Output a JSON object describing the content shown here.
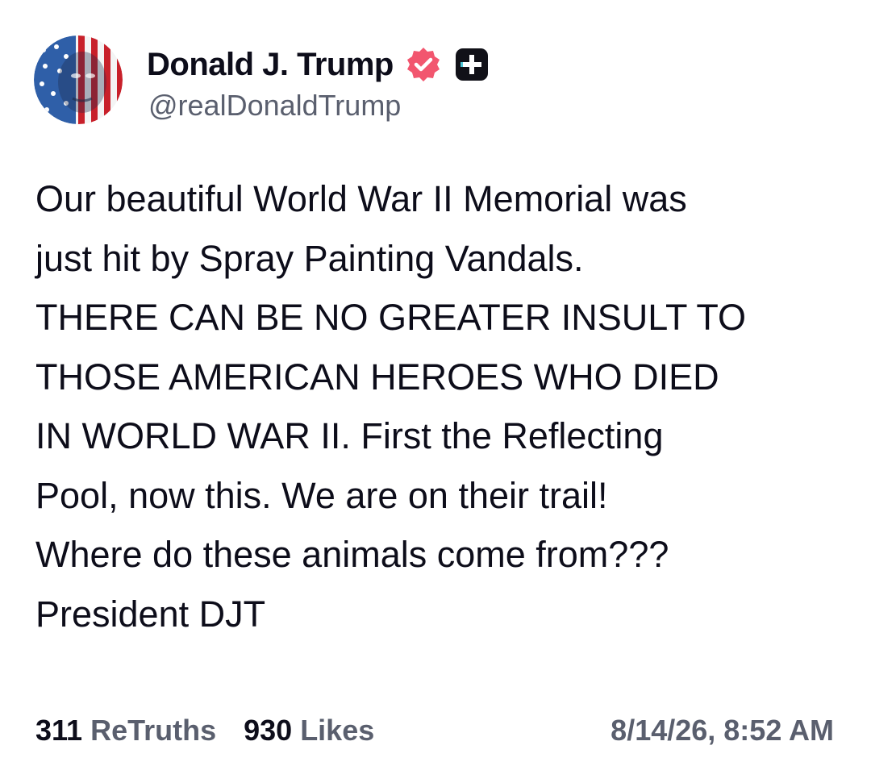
{
  "author": {
    "display_name": "Donald J. Trump",
    "handle": "@realDonaldTrump",
    "verified_icon": "verified-badge-icon",
    "extra_icon": "plus-box-icon",
    "accent_color": "#f2566f"
  },
  "post": {
    "lines": [
      "Our beautiful World War II Memorial was",
      "just hit by Spray Painting Vandals.",
      "THERE CAN BE NO GREATER INSULT TO",
      "THOSE AMERICAN HEROES WHO DIED",
      "IN WORLD WAR II. First the Reflecting",
      "Pool, now this. We are on their trail!",
      "Where do these animals come from???",
      "President DJT"
    ]
  },
  "stats": {
    "retruths_count": "311",
    "retruths_label": "ReTruths",
    "likes_count": "930",
    "likes_label": "Likes"
  },
  "timestamp": "8/14/26, 8:52 AM"
}
